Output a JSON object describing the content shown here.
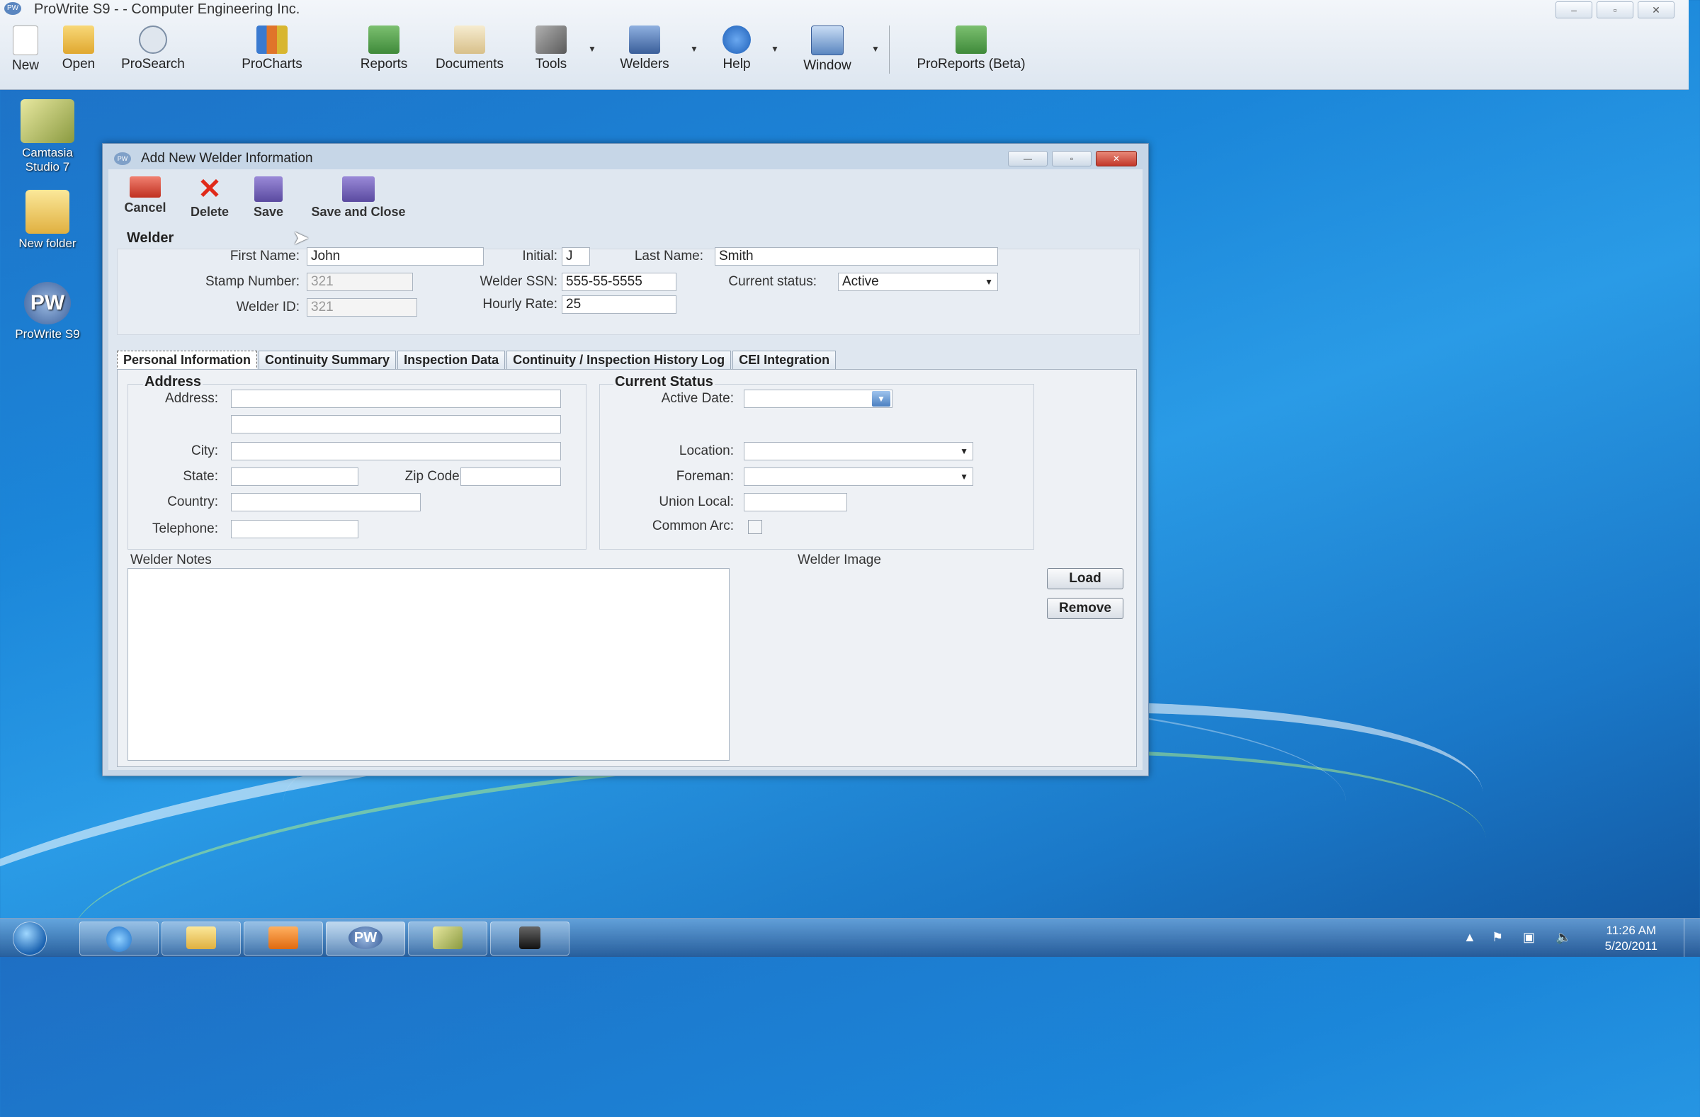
{
  "app": {
    "title": "ProWrite S9 -  - Computer Engineering Inc.",
    "logo": "PW",
    "window_controls": [
      "–",
      "▫",
      "✕"
    ],
    "toolbar": [
      {
        "label": "New",
        "icon": "new-document-icon",
        "color": "#ffffff"
      },
      {
        "label": "Open",
        "icon": "open-folder-icon",
        "color": "#f2c24a"
      },
      {
        "label": "ProSearch",
        "icon": "search-icon",
        "color": "#c9d3de"
      },
      {
        "label": "ProCharts",
        "icon": "bar-chart-icon",
        "color": "#e0742a"
      },
      {
        "label": "Reports",
        "icon": "reports-icon",
        "color": "#5a9a4a"
      },
      {
        "label": "Documents",
        "icon": "documents-icon",
        "color": "#e8d6a8"
      },
      {
        "label": "Tools",
        "icon": "tools-icon",
        "color": "#8a8a8a"
      },
      {
        "label": "Welders",
        "icon": "welders-icon",
        "color": "#5a7fb0"
      },
      {
        "label": "Help",
        "icon": "help-icon",
        "color": "#3a79d0"
      },
      {
        "label": "Window",
        "icon": "window-icon",
        "color": "#7ea6d6"
      },
      {
        "label": "ProReports (Beta)",
        "icon": "proreports-icon",
        "color": "#5a9a4a"
      }
    ]
  },
  "desktop": {
    "icons": [
      {
        "label": "Camtasia Studio 7",
        "icon": "camtasia-icon",
        "color": "#c8c86a"
      },
      {
        "label": "New folder",
        "icon": "folder-icon",
        "color": "#f2d36a"
      },
      {
        "label": "ProWrite S9",
        "icon": "prowrite-icon",
        "color": "#5a86c0",
        "glyph": "PW"
      }
    ]
  },
  "dialog": {
    "title": "Add New Welder Information",
    "logo": "PW",
    "controls": [
      "—",
      "▫",
      "✕"
    ],
    "toolbar": [
      {
        "label": "Cancel",
        "icon": "cancel-icon"
      },
      {
        "label": "Delete",
        "icon": "delete-icon"
      },
      {
        "label": "Save",
        "icon": "save-icon"
      },
      {
        "label": "Save and Close",
        "icon": "save-and-close-icon"
      }
    ],
    "welder": {
      "section": "Welder",
      "first_name_label": "First Name:",
      "first_name": "John",
      "initial_label": "Initial:",
      "initial": "J",
      "last_name_label": "Last Name:",
      "last_name": "Smith",
      "stamp_label": "Stamp Number:",
      "stamp": "321",
      "ssn_label": "Welder SSN:",
      "ssn": "555-55-5555",
      "status_label": "Current status:",
      "status": "Active",
      "id_label": "Welder ID:",
      "id": "321",
      "rate_label": "Hourly Rate:",
      "rate": "25"
    },
    "tabs": [
      "Personal Information",
      "Continuity Summary",
      "Inspection Data",
      "Continuity / Inspection History Log",
      "CEI Integration"
    ],
    "address": {
      "title": "Address",
      "address_label": "Address:",
      "city_label": "City:",
      "state_label": "State:",
      "zip_label": "Zip Code:",
      "country_label": "Country:",
      "phone_label": "Telephone:"
    },
    "status": {
      "title": "Current Status",
      "active_date_label": "Active Date:",
      "location_label": "Location:",
      "foreman_label": "Foreman:",
      "union_label": "Union Local:",
      "common_arc_label": "Common Arc:"
    },
    "notes_label": "Welder Notes",
    "image_label": "Welder Image",
    "load_label": "Load",
    "remove_label": "Remove"
  },
  "taskbar": {
    "time": "11:26 AM",
    "date": "5/20/2011",
    "buttons": [
      {
        "name": "ie",
        "icon": "internet-explorer-icon",
        "color": "#3a8ee0"
      },
      {
        "name": "explorer",
        "icon": "folder-icon",
        "color": "#f2d36a"
      },
      {
        "name": "media",
        "icon": "media-player-icon",
        "color": "#f08a2a"
      },
      {
        "name": "prowrite",
        "icon": "prowrite-icon",
        "color": "#5a86c0",
        "glyph": "PW"
      },
      {
        "name": "camtasia",
        "icon": "camtasia-icon",
        "color": "#c8c86a"
      },
      {
        "name": "recorder",
        "icon": "camera-icon",
        "color": "#3a3a3a"
      }
    ]
  }
}
